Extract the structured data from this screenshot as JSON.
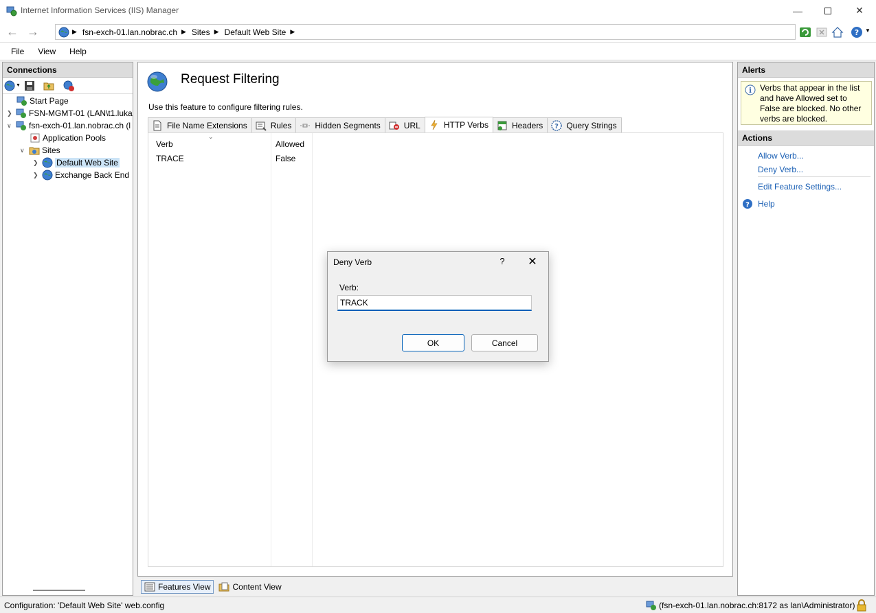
{
  "window": {
    "title": "Internet Information Services (IIS) Manager"
  },
  "address": {
    "crumbs": [
      "fsn-exch-01.lan.nobrac.ch",
      "Sites",
      "Default Web Site"
    ]
  },
  "menu": [
    "File",
    "View",
    "Help"
  ],
  "connections": {
    "header": "Connections",
    "tree": [
      {
        "label": "Start Page"
      },
      {
        "label": "FSN-MGMT-01 (LAN\\t1.luka"
      },
      {
        "label": "fsn-exch-01.lan.nobrac.ch (l"
      },
      {
        "label": "Application Pools"
      },
      {
        "label": "Sites"
      },
      {
        "label": "Default Web Site"
      },
      {
        "label": "Exchange Back End"
      }
    ]
  },
  "feature": {
    "title": "Request Filtering",
    "description": "Use this feature to configure filtering rules.",
    "tabs": [
      {
        "label": "File Name Extensions"
      },
      {
        "label": "Rules"
      },
      {
        "label": "Hidden Segments"
      },
      {
        "label": "URL"
      },
      {
        "label": "HTTP Verbs"
      },
      {
        "label": "Headers"
      },
      {
        "label": "Query Strings"
      }
    ],
    "columns": [
      "Verb",
      "Allowed"
    ],
    "rows": [
      {
        "verb": "TRACE",
        "allowed": "False"
      }
    ]
  },
  "views": {
    "features": "Features View",
    "content": "Content View"
  },
  "alerts": {
    "header": "Alerts",
    "message": "Verbs that appear in the list and have Allowed set to False are blocked. No other verbs are blocked."
  },
  "actions": {
    "header": "Actions",
    "allow": "Allow Verb...",
    "deny": "Deny Verb...",
    "edit": "Edit Feature Settings...",
    "help": "Help"
  },
  "status": {
    "left": "Configuration: 'Default Web Site' web.config",
    "right": "(fsn-exch-01.lan.nobrac.ch:8172 as lan\\Administrator)"
  },
  "dialog": {
    "title": "Deny Verb",
    "help": "?",
    "label": "Verb:",
    "value": "TRACK",
    "ok": "OK",
    "cancel": "Cancel"
  },
  "colors": {
    "accent": "#005fb8",
    "link": "#1a5fb4",
    "alert_bg": "#ffffe1",
    "selection": "#cce4f7"
  }
}
